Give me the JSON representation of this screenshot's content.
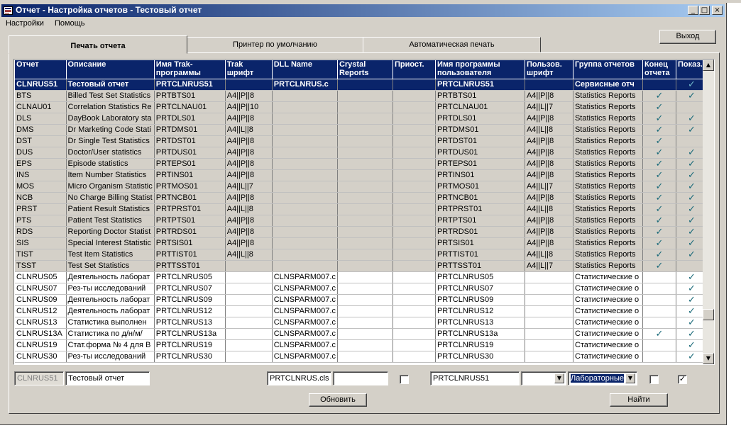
{
  "window": {
    "title": "Отчет - Настройка отчетов - Тестовый отчет",
    "buttons": {
      "minimize": "_",
      "maximize": "□",
      "close": "×"
    }
  },
  "menu": {
    "items": [
      "Настройки",
      "Помощь"
    ]
  },
  "tabs": [
    {
      "label": "Печать отчета",
      "active": true
    },
    {
      "label": "Принтер по умолчанию",
      "active": false
    },
    {
      "label": "Автоматическая печать",
      "active": false
    }
  ],
  "exit_label": "Выход",
  "columns": [
    "Отчет",
    "Описание",
    "Имя Trak-программы",
    "Trak шрифт",
    "DLL Name",
    "Crystal Reports",
    "Приост.",
    "Имя программы пользователя",
    "Пользов. шрифт",
    "Группа отчетов",
    "Конец отчета",
    "Показ."
  ],
  "check_mark": "✓",
  "rows": [
    {
      "report": "CLNRUS51",
      "desc": "Тестовый отчет",
      "trak": "PRTCLNRUS51",
      "font": "",
      "dll": "PRTCLNRUS.c",
      "crystal": "",
      "paused": "",
      "userprog": "PRTCLNRUS51",
      "userfont": "",
      "group": "Сервисные отч",
      "end": false,
      "show": true,
      "selected": true
    },
    {
      "report": "BTS",
      "desc": "Billed Test Set Statistics",
      "trak": "PRTBTS01",
      "font": "A4||P||8",
      "dll": "",
      "crystal": "",
      "paused": "",
      "userprog": "PRTBTS01",
      "userfont": "A4||P||8",
      "group": "Statistics Reports",
      "end": true,
      "show": true
    },
    {
      "report": "CLNAU01",
      "desc": "Correlation Statistics Re",
      "trak": "PRTCLNAU01",
      "font": "A4||P||10",
      "dll": "",
      "crystal": "",
      "paused": "",
      "userprog": "PRTCLNAU01",
      "userfont": "A4||L||7",
      "group": "Statistics Reports",
      "end": true,
      "show": false
    },
    {
      "report": "DLS",
      "desc": "DayBook Laboratory sta",
      "trak": "PRTDLS01",
      "font": "A4||P||8",
      "dll": "",
      "crystal": "",
      "paused": "",
      "userprog": "PRTDLS01",
      "userfont": "A4||P||8",
      "group": "Statistics Reports",
      "end": true,
      "show": true
    },
    {
      "report": "DMS",
      "desc": "Dr Marketing Code Stati",
      "trak": "PRTDMS01",
      "font": "A4||L||8",
      "dll": "",
      "crystal": "",
      "paused": "",
      "userprog": "PRTDMS01",
      "userfont": "A4||L||8",
      "group": "Statistics Reports",
      "end": true,
      "show": true
    },
    {
      "report": "DST",
      "desc": "Dr Single Test Statistics",
      "trak": "PRTDST01",
      "font": "A4||P||8",
      "dll": "",
      "crystal": "",
      "paused": "",
      "userprog": "PRTDST01",
      "userfont": "A4||P||8",
      "group": "Statistics Reports",
      "end": true,
      "show": false
    },
    {
      "report": "DUS",
      "desc": "Doctor/User statistics",
      "trak": "PRTDUS01",
      "font": "A4||P||8",
      "dll": "",
      "crystal": "",
      "paused": "",
      "userprog": "PRTDUS01",
      "userfont": "A4||P||8",
      "group": "Statistics Reports",
      "end": true,
      "show": true
    },
    {
      "report": "EPS",
      "desc": "Episode statistics",
      "trak": "PRTEPS01",
      "font": "A4||P||8",
      "dll": "",
      "crystal": "",
      "paused": "",
      "userprog": "PRTEPS01",
      "userfont": "A4||P||8",
      "group": "Statistics Reports",
      "end": true,
      "show": true
    },
    {
      "report": "INS",
      "desc": "Item Number Statistics",
      "trak": "PRTINS01",
      "font": "A4||P||8",
      "dll": "",
      "crystal": "",
      "paused": "",
      "userprog": "PRTINS01",
      "userfont": "A4||P||8",
      "group": "Statistics Reports",
      "end": true,
      "show": true
    },
    {
      "report": "MOS",
      "desc": "Micro Organism Statistic",
      "trak": "PRTMOS01",
      "font": "A4||L||7",
      "dll": "",
      "crystal": "",
      "paused": "",
      "userprog": "PRTMOS01",
      "userfont": "A4||L||7",
      "group": "Statistics Reports",
      "end": true,
      "show": true
    },
    {
      "report": "NCB",
      "desc": "No Charge Billing Statist",
      "trak": "PRTNCB01",
      "font": "A4||P||8",
      "dll": "",
      "crystal": "",
      "paused": "",
      "userprog": "PRTNCB01",
      "userfont": "A4||P||8",
      "group": "Statistics Reports",
      "end": true,
      "show": true
    },
    {
      "report": "PRST",
      "desc": "Patient Result Statistics",
      "trak": "PRTPRST01",
      "font": "A4||L||8",
      "dll": "",
      "crystal": "",
      "paused": "",
      "userprog": "PRTPRST01",
      "userfont": "A4||L||8",
      "group": "Statistics Reports",
      "end": true,
      "show": true
    },
    {
      "report": "PTS",
      "desc": "Patient Test Statistics",
      "trak": "PRTPTS01",
      "font": "A4||P||8",
      "dll": "",
      "crystal": "",
      "paused": "",
      "userprog": "PRTPTS01",
      "userfont": "A4||P||8",
      "group": "Statistics Reports",
      "end": true,
      "show": true
    },
    {
      "report": "RDS",
      "desc": "Reporting Doctor Statist",
      "trak": "PRTRDS01",
      "font": "A4||P||8",
      "dll": "",
      "crystal": "",
      "paused": "",
      "userprog": "PRTRDS01",
      "userfont": "A4||P||8",
      "group": "Statistics Reports",
      "end": true,
      "show": true
    },
    {
      "report": "SIS",
      "desc": "Special Interest Statistic",
      "trak": "PRTSIS01",
      "font": "A4||P||8",
      "dll": "",
      "crystal": "",
      "paused": "",
      "userprog": "PRTSIS01",
      "userfont": "A4||P||8",
      "group": "Statistics Reports",
      "end": true,
      "show": true
    },
    {
      "report": "TIST",
      "desc": "Test Item Statistics",
      "trak": "PRTTIST01",
      "font": "A4||L||8",
      "dll": "",
      "crystal": "",
      "paused": "",
      "userprog": "PRTTIST01",
      "userfont": "A4||L||8",
      "group": "Statistics Reports",
      "end": true,
      "show": true
    },
    {
      "report": "TSST",
      "desc": "Test Set Statistics",
      "trak": "PRTTSST01",
      "font": "",
      "dll": "",
      "crystal": "",
      "paused": "",
      "userprog": "PRTTSST01",
      "userfont": "A4||L||7",
      "group": "Statistics Reports",
      "end": true,
      "show": false
    },
    {
      "report": "CLNRUS05",
      "desc": "Деятельность лаборат",
      "trak": "PRTCLNRUS05",
      "font": "",
      "dll": "CLNSPARM007.c",
      "crystal": "",
      "paused": "",
      "userprog": "PRTCLNRUS05",
      "userfont": "",
      "group": "Статистические о",
      "end": false,
      "show": true
    },
    {
      "report": "CLNRUS07",
      "desc": "Рез-ты исследований",
      "trak": "PRTCLNRUS07",
      "font": "",
      "dll": "CLNSPARM007.c",
      "crystal": "",
      "paused": "",
      "userprog": "PRTCLNRUS07",
      "userfont": "",
      "group": "Статистические о",
      "end": false,
      "show": true
    },
    {
      "report": "CLNRUS09",
      "desc": "Деятельность лаборат",
      "trak": "PRTCLNRUS09",
      "font": "",
      "dll": "CLNSPARM007.c",
      "crystal": "",
      "paused": "",
      "userprog": "PRTCLNRUS09",
      "userfont": "",
      "group": "Статистические о",
      "end": false,
      "show": true
    },
    {
      "report": "CLNRUS12",
      "desc": "Деятельность лаборат",
      "trak": "PRTCLNRUS12",
      "font": "",
      "dll": "CLNSPARM007.c",
      "crystal": "",
      "paused": "",
      "userprog": "PRTCLNRUS12",
      "userfont": "",
      "group": "Статистические о",
      "end": false,
      "show": true
    },
    {
      "report": "CLNRUS13",
      "desc": "Статистика выполнен",
      "trak": "PRTCLNRUS13",
      "font": "",
      "dll": "CLNSPARM007.c",
      "crystal": "",
      "paused": "",
      "userprog": "PRTCLNRUS13",
      "userfont": "",
      "group": "Статистические о",
      "end": false,
      "show": true
    },
    {
      "report": "CLNRUS13A",
      "desc": "Статистика по д/н/м/",
      "trak": "PRTCLNRUS13a",
      "font": "",
      "dll": "CLNSPARM007.c",
      "crystal": "",
      "paused": "",
      "userprog": "PRTCLNRUS13a",
      "userfont": "",
      "group": "Статистические о",
      "end": true,
      "show": true
    },
    {
      "report": "CLNRUS19",
      "desc": "Стат.форма № 4 для В",
      "trak": "PRTCLNRUS19",
      "font": "",
      "dll": "CLNSPARM007.c",
      "crystal": "",
      "paused": "",
      "userprog": "PRTCLNRUS19",
      "userfont": "",
      "group": "Статистические о",
      "end": false,
      "show": true
    },
    {
      "report": "CLNRUS30",
      "desc": "Рез-ты исследований",
      "trak": "PRTCLNRUS30",
      "font": "",
      "dll": "CLNSPARM007.c",
      "crystal": "",
      "paused": "",
      "userprog": "PRTCLNRUS30",
      "userfont": "",
      "group": "Статистические о",
      "end": false,
      "show": true
    }
  ],
  "edit": {
    "report": "CLNRUS51",
    "desc": "Тестовый отчет",
    "dll": "PRTCLNRUS.cls",
    "crystal": "",
    "userprog": "PRTCLNRUS51",
    "userfont": "",
    "group": "Лабораторные",
    "end": false,
    "show": true
  },
  "update_label": "Обновить",
  "find_label": "Найти",
  "scroll_arrows": {
    "up": "▲",
    "down": "▼"
  },
  "combo_arrow": "▼"
}
